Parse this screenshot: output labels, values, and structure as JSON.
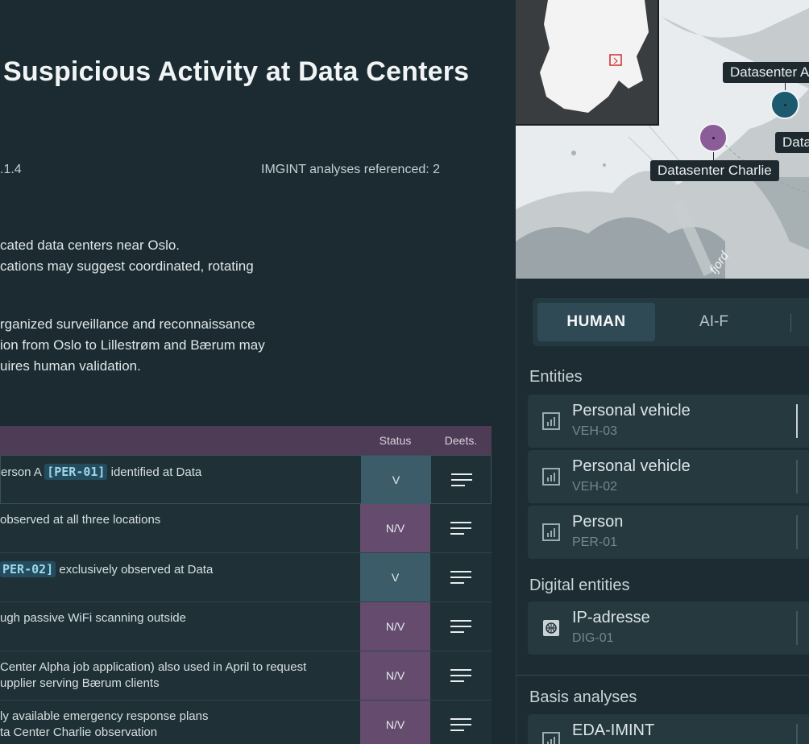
{
  "report": {
    "title": "Suspicious Activity at Data Centers",
    "meta_left": ".1.4",
    "meta_right": "IMGINT analyses referenced: 2",
    "para1": [
      "cated data centers near Oslo.",
      "cations may suggest coordinated, rotating"
    ],
    "para2": [
      "rganized surveillance and reconnaissance",
      "ion from Oslo to Lillestrøm and Bærum may",
      "uires human validation."
    ]
  },
  "table": {
    "status_header": "Status",
    "deets_header": "Deets.",
    "rows": [
      {
        "pre": "erson A ",
        "chip": "[PER-01]",
        "post": " identified at Data",
        "line2": "",
        "status": "V"
      },
      {
        "pre": "observed at all three locations",
        "chip": "",
        "post": "",
        "line2": "",
        "status": "N/V"
      },
      {
        "pre": "",
        "chip": "PER-02]",
        "post": " exclusively observed at Data",
        "line2": "",
        "status": "V"
      },
      {
        "pre": "ugh passive WiFi scanning outside",
        "chip": "",
        "post": "",
        "line2": "",
        "status": "N/V"
      },
      {
        "pre": " Center Alpha job application) also used in April to request",
        "chip": "",
        "post": "",
        "line2": "upplier serving Bærum clients",
        "status": "N/V"
      },
      {
        "pre": "ly available emergency response plans",
        "chip": "",
        "post": "",
        "line2": "ta Center Charlie observation",
        "status": "N/V"
      }
    ]
  },
  "map": {
    "label_alpha": "Datasenter A",
    "label_charlie": "Datasenter Charlie",
    "label_bravo": "Data",
    "water_label": "fjord",
    "marker_alpha_color": "#1c5a70",
    "marker_charlie_color": "#8a5c98"
  },
  "panel": {
    "tabs": [
      "HUMAN",
      "AI-F"
    ],
    "entities_heading": "Entities",
    "entities": [
      {
        "name": "Personal vehicle",
        "code": "VEH-03"
      },
      {
        "name": "Personal vehicle",
        "code": "VEH-02"
      },
      {
        "name": "Person",
        "code": "PER-01"
      }
    ],
    "digital_heading": "Digital entities",
    "digital": [
      {
        "name": "IP-adresse",
        "code": "DIG-01"
      }
    ],
    "basis_heading": "Basis analyses",
    "basis": [
      {
        "name": "EDA-IMINT",
        "code": ""
      }
    ]
  }
}
